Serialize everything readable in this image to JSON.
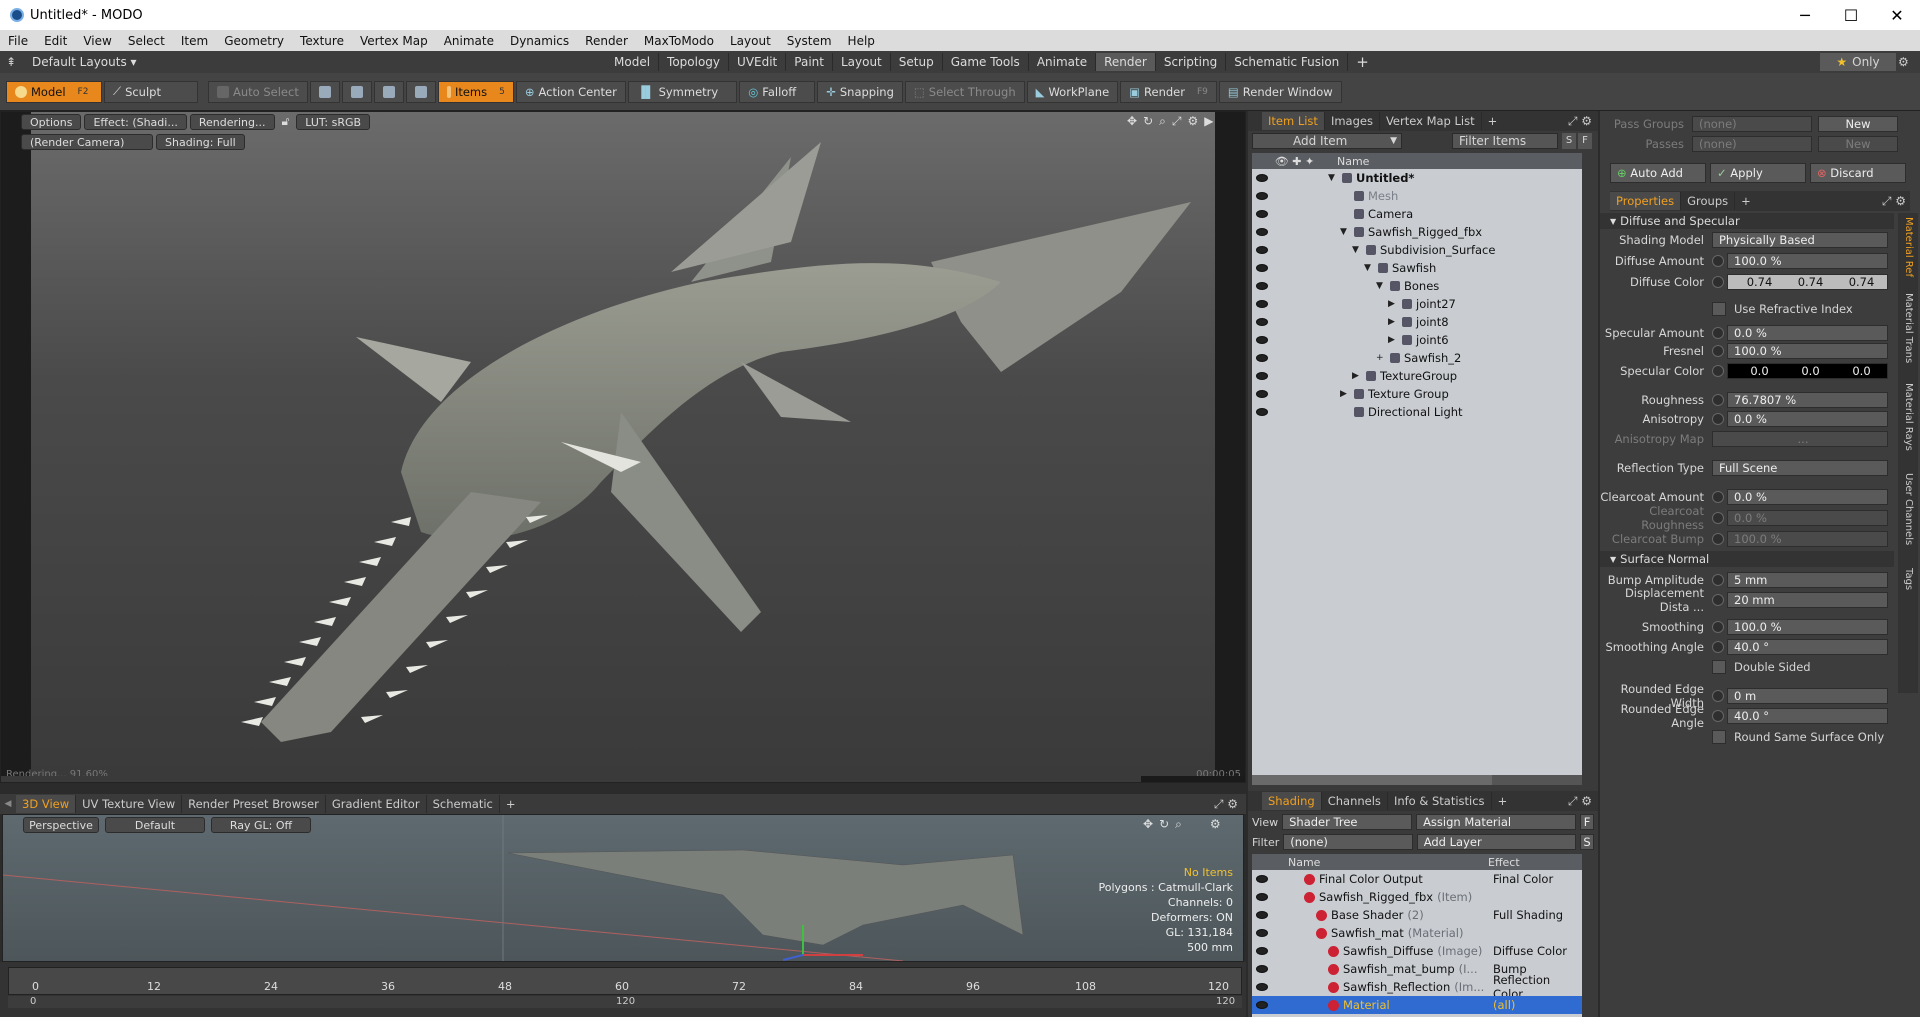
{
  "window": {
    "title": "Untitled* - MODO",
    "buttons": [
      "─",
      "☐",
      "✕"
    ]
  },
  "menu": [
    "File",
    "Edit",
    "View",
    "Select",
    "Item",
    "Geometry",
    "Texture",
    "Vertex Map",
    "Animate",
    "Dynamics",
    "Render",
    "MaxToModo",
    "Layout",
    "System",
    "Help"
  ],
  "layout_selector": "Default Layouts ▾",
  "layout_tabs": [
    "Model",
    "Topology",
    "UVEdit",
    "Paint",
    "Layout",
    "Setup",
    "Game Tools",
    "Animate",
    "Render",
    "Scripting",
    "Schematic Fusion",
    "+"
  ],
  "active_layout_tab": "Render",
  "only_button": "Only",
  "toolbar": {
    "model": "Model",
    "model_key": "F2",
    "sculpt": "Sculpt",
    "auto_select": "Auto Select",
    "items": "Items",
    "items_key": "5",
    "action_center": "Action Center",
    "symmetry": "Symmetry",
    "falloff": "Falloff",
    "snapping": "Snapping",
    "select_through": "Select Through",
    "workplane": "WorkPlane",
    "render": "Render",
    "render_key": "F9",
    "render_window": "Render Window"
  },
  "viewport": {
    "options": "Options",
    "effect": "Effect: (Shadi...",
    "rendering": "Rendering...",
    "lut": "LUT: sRGB",
    "camera": "(Render Camera)",
    "shading": "Shading: Full",
    "status": "Rendering... 91.60%",
    "time": "00:00:05"
  },
  "lower_tabs": [
    "3D View",
    "UV Texture View",
    "Render Preset Browser",
    "Gradient Editor",
    "Schematic",
    "+"
  ],
  "view3d": {
    "perspective": "Perspective",
    "default": "Default",
    "raygl": "Ray GL: Off",
    "info": [
      "No Items",
      "Polygons : Catmull-Clark",
      "Channels: 0",
      "Deformers: ON",
      "GL: 131,184",
      "500 mm"
    ]
  },
  "timeline": {
    "ticks": [
      "0",
      "12",
      "24",
      "36",
      "48",
      "60",
      "72",
      "84",
      "96",
      "108",
      "120"
    ],
    "start": "0",
    "mid": "120",
    "end": "120"
  },
  "item_list": {
    "tabs": [
      "Item List",
      "Images",
      "Vertex Map List",
      "+"
    ],
    "add_item": "Add Item",
    "filter": "Filter Items",
    "s": "S",
    "f": "F",
    "col_name": "Name",
    "items": [
      {
        "label": "Untitled*",
        "indent": 0,
        "arrow": "▼",
        "bold": true
      },
      {
        "label": "Mesh",
        "indent": 1,
        "arrow": "",
        "dim": true
      },
      {
        "label": "Camera",
        "indent": 1,
        "arrow": ""
      },
      {
        "label": "Sawfish_Rigged_fbx",
        "indent": 1,
        "arrow": "▼"
      },
      {
        "label": "Subdivision_Surface",
        "indent": 2,
        "arrow": "▼"
      },
      {
        "label": "Sawfish",
        "indent": 3,
        "arrow": "▼"
      },
      {
        "label": "Bones",
        "indent": 4,
        "arrow": "▼"
      },
      {
        "label": "joint27",
        "indent": 5,
        "arrow": "▶"
      },
      {
        "label": "joint8",
        "indent": 5,
        "arrow": "▶"
      },
      {
        "label": "joint6",
        "indent": 5,
        "arrow": "▶"
      },
      {
        "label": "Sawfish_2",
        "indent": 4,
        "arrow": "+"
      },
      {
        "label": "TextureGroup",
        "indent": 2,
        "arrow": "▶"
      },
      {
        "label": "Texture Group",
        "indent": 1,
        "arrow": "▶"
      },
      {
        "label": "Directional Light",
        "indent": 1,
        "arrow": ""
      }
    ]
  },
  "shading": {
    "tabs": [
      "Shading",
      "Channels",
      "Info & Statistics",
      "+"
    ],
    "view_label": "View",
    "view_value": "Shader Tree",
    "assign": "Assign Material",
    "f": "F",
    "filter_label": "Filter",
    "filter_value": "(none)",
    "add_layer": "Add Layer",
    "s": "S",
    "col_name": "Name",
    "col_effect": "Effect",
    "rows": [
      {
        "name": "Final Color Output",
        "type": "",
        "effect": "Final Color",
        "indent": 1
      },
      {
        "name": "Sawfish_Rigged_fbx",
        "type": "(Item)",
        "effect": "",
        "indent": 1
      },
      {
        "name": "Base Shader",
        "type": "(2)",
        "effect": "Full Shading",
        "indent": 2
      },
      {
        "name": "Sawfish_mat",
        "type": "(Material)",
        "effect": "",
        "indent": 2
      },
      {
        "name": "Sawfish_Diffuse",
        "type": "(Image)",
        "effect": "Diffuse Color",
        "indent": 3
      },
      {
        "name": "Sawfish_mat_bump",
        "type": "(I...",
        "effect": "Bump",
        "indent": 3
      },
      {
        "name": "Sawfish_Reflection",
        "type": "(Im...",
        "effect": "Reflection Color",
        "indent": 3
      },
      {
        "name": "Material",
        "type": "",
        "effect": "(all)",
        "indent": 3,
        "selected": true
      }
    ]
  },
  "pass_groups": {
    "label": "Pass Groups",
    "value": "(none)",
    "new": "New",
    "passes": "Passes",
    "passes_value": "(none)",
    "new2": "New"
  },
  "actions": {
    "auto_add": "Auto Add",
    "apply": "Apply",
    "discard": "Discard"
  },
  "properties": {
    "tabs": [
      "Properties",
      "Groups",
      "+"
    ],
    "side_tabs": [
      "Material Ref",
      "Material Trans",
      "Material Rays",
      "User Channels",
      "Tags"
    ],
    "sections": {
      "diffuse": "Diffuse and Specular",
      "surface": "Surface Normal"
    },
    "shading_model": {
      "label": "Shading Model",
      "value": "Physically Based"
    },
    "diffuse_amount": {
      "label": "Diffuse Amount",
      "value": "100.0 %"
    },
    "diffuse_color": {
      "label": "Diffuse Color",
      "r": "0.74",
      "g": "0.74",
      "b": "0.74"
    },
    "use_refractive": "Use Refractive Index",
    "specular_amount": {
      "label": "Specular Amount",
      "value": "0.0 %"
    },
    "fresnel": {
      "label": "Fresnel",
      "value": "100.0 %"
    },
    "specular_color": {
      "label": "Specular Color",
      "r": "0.0",
      "g": "0.0",
      "b": "0.0"
    },
    "roughness": {
      "label": "Roughness",
      "value": "76.7807 %"
    },
    "anisotropy": {
      "label": "Anisotropy",
      "value": "0.0 %"
    },
    "anisotropy_map": {
      "label": "Anisotropy Map",
      "value": "..."
    },
    "reflection_type": {
      "label": "Reflection Type",
      "value": "Full Scene"
    },
    "clearcoat_amount": {
      "label": "Clearcoat Amount",
      "value": "0.0 %"
    },
    "clearcoat_roughness": {
      "label": "Clearcoat Roughness",
      "value": "0.0 %"
    },
    "clearcoat_bump": {
      "label": "Clearcoat Bump",
      "value": "100.0 %"
    },
    "bump_amplitude": {
      "label": "Bump Amplitude",
      "value": "5 mm"
    },
    "displacement": {
      "label": "Displacement Dista ...",
      "value": "20 mm"
    },
    "smoothing": {
      "label": "Smoothing",
      "value": "100.0 %"
    },
    "smoothing_angle": {
      "label": "Smoothing Angle",
      "value": "40.0 °"
    },
    "double_sided": "Double Sided",
    "rounded_width": {
      "label": "Rounded Edge Width",
      "value": "0 m"
    },
    "rounded_angle": {
      "label": "Rounded Edge Angle",
      "value": "40.0 °"
    },
    "round_same": "Round Same Surface Only"
  },
  "colors": {
    "accent": "#e8881c",
    "selected_row": "#2f6bd1",
    "tree_bg": "#c9cdd2"
  }
}
